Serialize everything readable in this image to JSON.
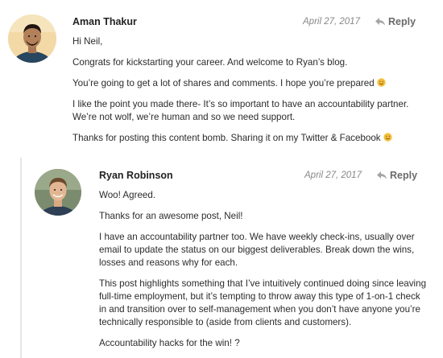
{
  "comments": [
    {
      "author": "Aman Thakur",
      "date": "April 27, 2017",
      "reply_label": "Reply",
      "paragraphs": [
        [
          "Hi Neil,"
        ],
        [
          "Congrats for kickstarting your career. And welcome to Ryan’s blog."
        ],
        [
          "You’re going to get a lot of shares and comments. I hope you’re prepared"
        ],
        [
          "I like the point you made there- It’s so important to have an accountability partner.",
          "We’re not wolf, we’re human and so we need support."
        ],
        [
          "Thanks for posting this content bomb. Sharing it on my Twitter & Facebook"
        ]
      ],
      "emojis": {
        "p2": "smile-emoji",
        "p4": "smile-emoji"
      }
    },
    {
      "author": "Ryan Robinson",
      "date": "April 27, 2017",
      "reply_label": "Reply",
      "paragraphs": [
        [
          "Woo! Agreed."
        ],
        [
          "Thanks for an awesome post, Neil!"
        ],
        [
          "I have an accountability partner too. We have weekly check-ins, usually over",
          "email to update the status on our biggest deliverables. Break down the wins,",
          "losses and reasons why for each."
        ],
        [
          "This post highlights something that I’ve intuitively continued doing since leaving",
          "full-time employment, but it’s tempting to throw away this type of 1-on-1 check",
          "in and transition over to self-management when you don’t have anyone you’re",
          "technically responsible to (aside from clients and customers)."
        ],
        [
          "Accountability hacks for the win! ?"
        ]
      ]
    }
  ],
  "icons": {
    "reply": "reply-arrow-icon",
    "emoji": "smile-emoji-icon"
  },
  "colors": {
    "text": "#2b2b2b",
    "muted": "#888888",
    "reply": "#6b6b6b",
    "emoji": "#f5c13d"
  }
}
